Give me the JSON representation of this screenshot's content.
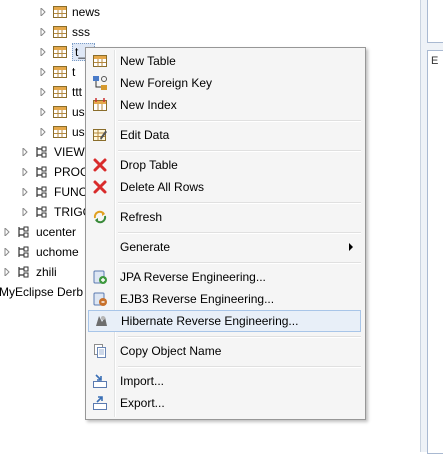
{
  "tree": {
    "tables": [
      {
        "label": "news"
      },
      {
        "label": "sss"
      },
      {
        "label": "t_u"
      },
      {
        "label": "t"
      },
      {
        "label": "ttt"
      },
      {
        "label": "us"
      },
      {
        "label": "us"
      }
    ],
    "folders": [
      {
        "label": "VIEW"
      },
      {
        "label": "PROC"
      },
      {
        "label": "FUNC"
      },
      {
        "label": "TRIGG"
      }
    ],
    "schemas": [
      {
        "label": "ucenter"
      },
      {
        "label": "uchome"
      },
      {
        "label": "zhili"
      }
    ],
    "connection": {
      "label": "MyEclipse Derb"
    }
  },
  "right_panel": {
    "label": "E"
  },
  "context_menu": {
    "items": [
      {
        "label": "New Table",
        "icon": "table-icon"
      },
      {
        "label": "New Foreign Key",
        "icon": "foreign-key-icon"
      },
      {
        "label": "New Index",
        "icon": "index-icon"
      },
      {
        "label": "Edit Data",
        "icon": "edit-data-icon"
      },
      {
        "label": "Drop Table",
        "icon": "red-x-icon"
      },
      {
        "label": "Delete All Rows",
        "icon": "red-x-icon"
      },
      {
        "label": "Refresh",
        "icon": "refresh-icon"
      },
      {
        "label": "Generate",
        "icon": "",
        "submenu": true
      },
      {
        "label": "JPA Reverse Engineering...",
        "icon": "jpa-icon"
      },
      {
        "label": "EJB3 Reverse Engineering...",
        "icon": "ejb3-icon"
      },
      {
        "label": "Hibernate Reverse Engineering...",
        "icon": "hibernate-icon",
        "highlighted": true
      },
      {
        "label": "Copy Object Name",
        "icon": "copy-icon"
      },
      {
        "label": "Import...",
        "icon": "import-icon"
      },
      {
        "label": "Export...",
        "icon": "export-icon"
      }
    ]
  },
  "colors": {
    "menu_bg": "#f5f5f5",
    "menu_border": "#979797",
    "highlight_bg": "#e8eff8",
    "highlight_border": "#a8c5e8",
    "selection": "#dfe8f6"
  }
}
